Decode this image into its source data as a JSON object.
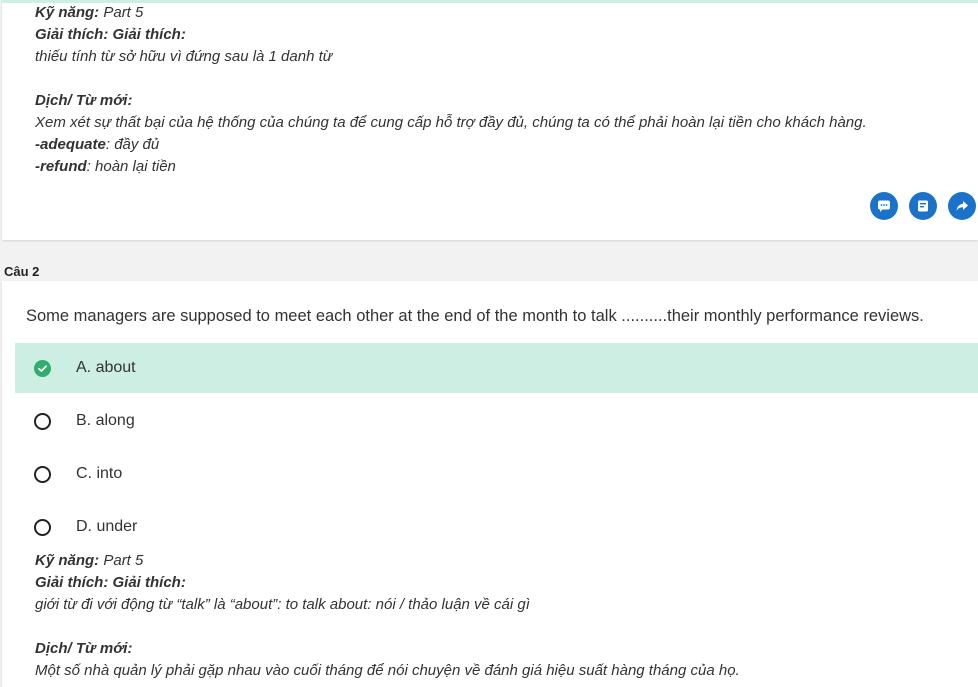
{
  "q1": {
    "skill_label": "Kỹ năng:",
    "skill_value": "Part 5",
    "expl_label": "Giải thích: Giải thích:",
    "expl_text": "thiếu tính từ sở hữu vì đứng sau là 1 danh từ",
    "vocab_label": "Dịch/ Từ mới:",
    "translation": "Xem xét sự thất bại của hệ thống của chúng ta để cung cấp hỗ trợ đầy đủ, chúng ta có thể phải hoàn lại tiền cho khách hàng.",
    "vocab": [
      {
        "word": "-adequate",
        "meaning": ": đầy đủ"
      },
      {
        "word": "-refund",
        "meaning": ": hoàn lại tiền"
      }
    ]
  },
  "actions": [
    {
      "icon": "comment-icon"
    },
    {
      "icon": "note-icon"
    },
    {
      "icon": "share-icon"
    }
  ],
  "q2": {
    "label": "Câu 2",
    "question": "Some managers are supposed to meet each other at the end of the month to talk ..........their monthly performance reviews.",
    "options": [
      {
        "label": "A. about",
        "correct": true
      },
      {
        "label": "B. along",
        "correct": false
      },
      {
        "label": "C. into",
        "correct": false
      },
      {
        "label": "D. under",
        "correct": false
      }
    ],
    "skill_label": "Kỹ năng:",
    "skill_value": "Part 5",
    "expl_label": "Giải thích: Giải thích:",
    "expl_text": "giới từ đi với động từ “talk” là “about”: to talk about: nói / thảo luận về cái gì",
    "vocab_label": "Dịch/ Từ mới:",
    "translation": "Một số nhà quản lý phải gặp nhau vào cuối tháng để nói chuyện về đánh giá hiệu suất hàng tháng của họ."
  },
  "colors": {
    "correct_bg": "#cdeee2",
    "check": "#2fae6f",
    "action": "#1a73c9"
  }
}
